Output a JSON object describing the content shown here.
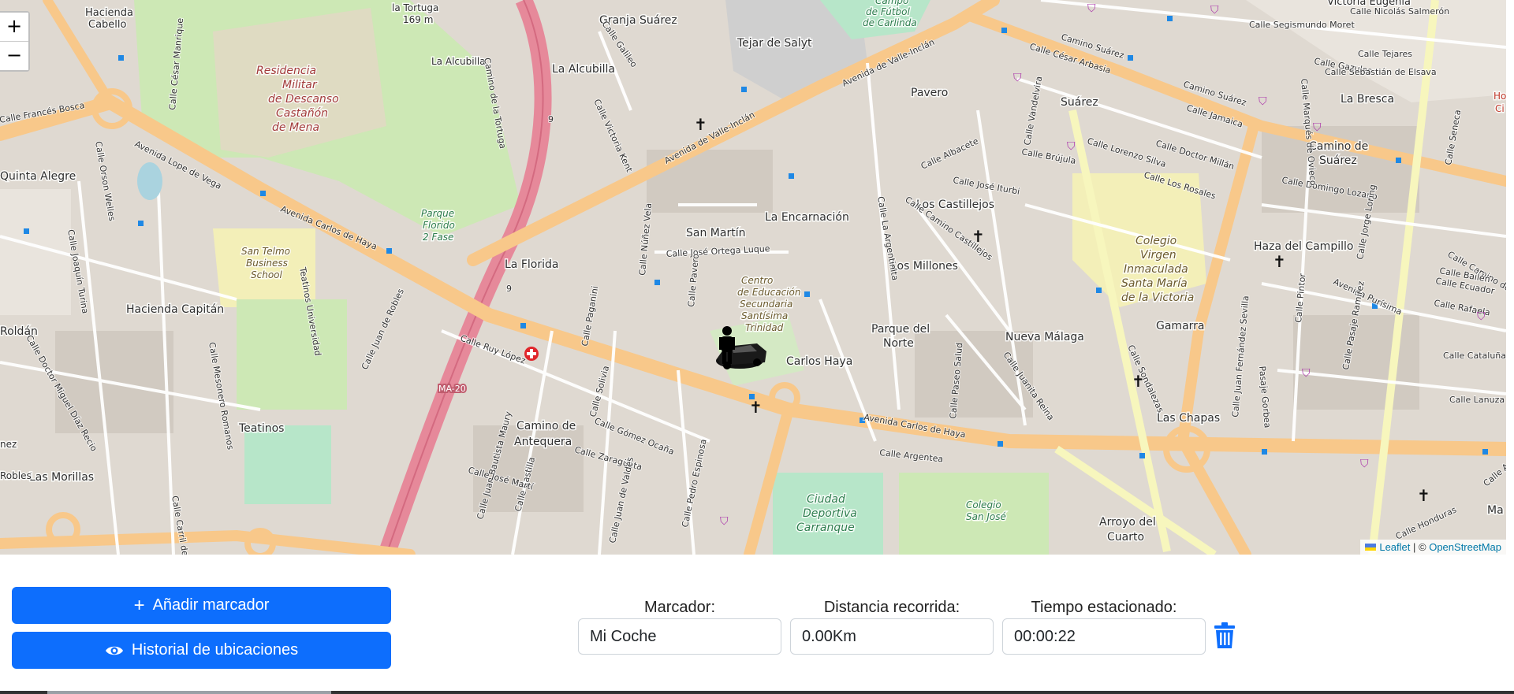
{
  "map": {
    "zoom_in": "+",
    "zoom_out": "−",
    "attribution": {
      "leaflet": "Leaflet",
      "separator": "| ©",
      "osm": "OpenStreetMap"
    },
    "place_labels": [
      "Residencia",
      "Militar",
      "de Descanso",
      "Castañón",
      "de Mena",
      "Granja Suárez",
      "Tejar de Salyt",
      "La Alcubilla",
      "La Alcubilla",
      "La Encarnación",
      "San Martín",
      "La Florida",
      "Los Castillejos",
      "Los Millones",
      "Parque del",
      "Norte",
      "Nueva Málaga",
      "Carlos Haya",
      "Hacienda Capitán",
      "Teatinos",
      "Las Morillas",
      "Camino de",
      "Antequera",
      "Suárez",
      "Pavero",
      "La Bresca",
      "Camino de",
      "Suárez",
      "Haza del Campillo",
      "Gamarra",
      "Las Chapas",
      "Arroyo del",
      "Cuarto",
      "Quinta Alegre",
      "Ciudad",
      "Deportiva",
      "Carranque",
      "Colegio",
      "Virgen",
      "Inmaculada",
      "Santa María",
      "de la Victoria",
      "Centro",
      "de Educación",
      "Secundaria",
      "Santísima",
      "Trinidad",
      "San Telmo",
      "Business",
      "School",
      "Parque",
      "Florido",
      "2 Fase",
      "Hacienda",
      "Cabello",
      "la Tortuga",
      "169 m",
      "Colegio",
      "San José",
      "Campo",
      "de Fútbol",
      "de Carlinda",
      "Victoria Eugenia",
      "Ho",
      "Ci",
      "Roldán",
      "Ma",
      "Robles",
      "nez"
    ],
    "road_labels": [
      "Avenida Carlos de Haya",
      "Avenida Carlos de Haya",
      "Avenida de Valle-Inclán",
      "Avenida de Valle-Inclán",
      "Avenida Lope de Vega",
      "Camino Suárez",
      "Camino Suárez",
      "Calle Argentea",
      "MA-20",
      "9",
      "9",
      "Calle José Ortega Luque",
      "Calle Ruy López",
      "Calle Gómez Ocaña",
      "Calle Juan de Robles",
      "Calle Lorenzo Silva",
      "Calle Doctor Millán",
      "Calle Los Rosales",
      "Calle Domingo Lozano",
      "Calle Jamaica",
      "Calle Sondalezas",
      "Calle Juanita Reina",
      "Calle La Argentinita",
      "Calle Camino Castillejos",
      "Calle Albacete",
      "Calle José Iturbi",
      "Calle Brújula",
      "Calle César Arbasia",
      "Calle Orson Welles",
      "Calle Doctor Miguel Díaz Recio",
      "Calle Joaquín Turina",
      "Calle Mesonero Romanos",
      "Calle Castilla",
      "Calle Zaragüeta",
      "Calle Juan Bautista Maury",
      "Calle Pedro Espinosa",
      "Calle Juan de Valdés",
      "Calle Paganini",
      "Calle Núñez Vela",
      "Calle Pavero",
      "Calle Galileo",
      "Calle Victoria Kent",
      "Calle Camino de los Almendrales",
      "Avenida Purísima",
      "Calle Cataluña",
      "Calle Lanuza",
      "Calle Rafaela",
      "Calle Ecuador",
      "Calle Bailén",
      "Calle Jorge Loring",
      "Calle Seneca",
      "Calle Tejares",
      "Calle Gazules",
      "Calle Sebastián de Elsava",
      "Calle Segismundo Moret",
      "Calle Nicolás Salmerón",
      "Calle Juan Fernández Sevilla",
      "Pasaje Gorbea",
      "Calle José Martí",
      "Calle Solivia",
      "Camino de la Tortuga",
      "Calle Carril del Capitán",
      "Calle Paseo Salud",
      "Calle Honduras",
      "Calle Arango",
      "Calle César Manrique",
      "Calle Francés Bosca",
      "Teatinos Universidad",
      "Calle Marqués de Ovieco",
      "Calle Pintor",
      "Calle Vandelvira",
      "Calle Pasaje Ramírez"
    ]
  },
  "buttons": {
    "add_marker": {
      "icon": "+",
      "label": "Añadir marcador"
    },
    "history": {
      "label": "Historial de ubicaciones"
    }
  },
  "fields": {
    "marker": {
      "label": "Marcador:",
      "value": "Mi Coche"
    },
    "distance": {
      "label": "Distancia recorrida:",
      "value": "0.00Km"
    },
    "parked_time": {
      "label": "Tiempo estacionado:",
      "value": "00:00:22"
    }
  },
  "colors": {
    "primary": "#0d6efd",
    "trash": "#0d6efd",
    "major_road": "#f8c88a",
    "motorway": "#e6899a",
    "park": "#cde8b5",
    "urban": "#dfd9d1"
  },
  "icons": {
    "marker": "person-car-icon",
    "trash": "trash-icon",
    "eye": "eye-icon",
    "plus": "plus-icon"
  }
}
